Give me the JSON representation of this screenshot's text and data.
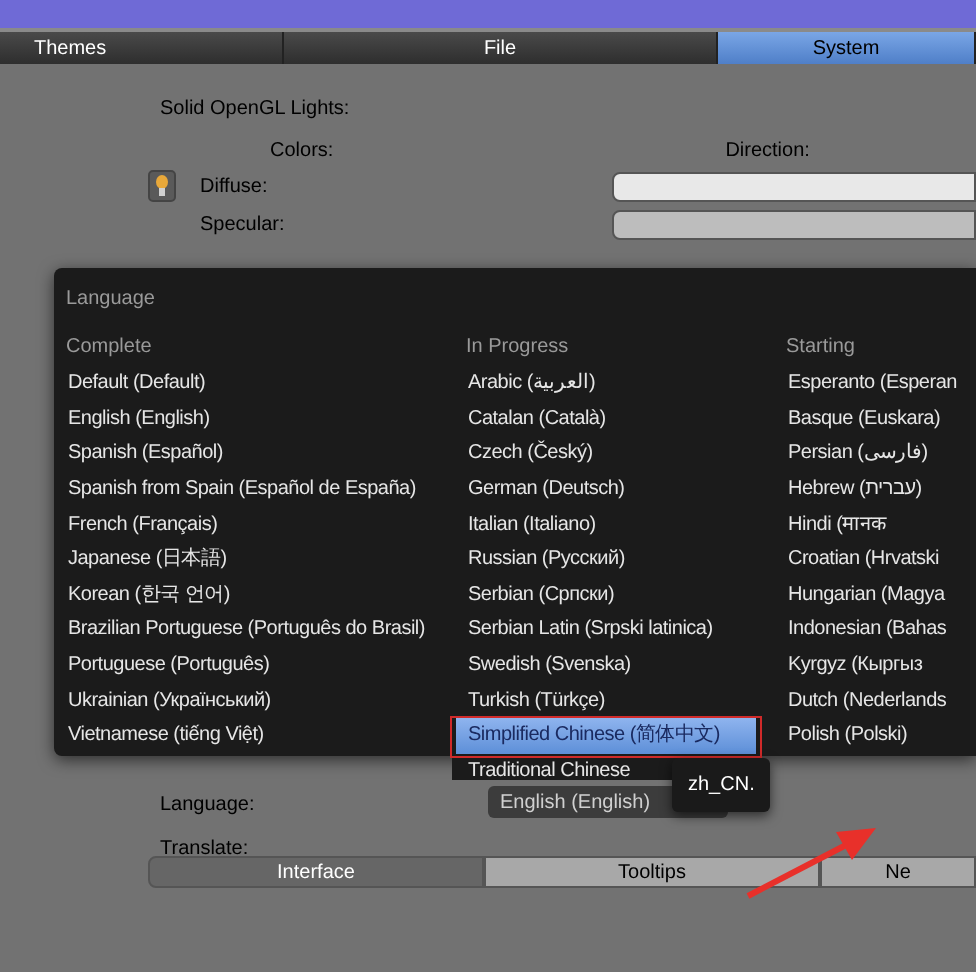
{
  "top_tabs": [
    {
      "label": "Themes",
      "selected": false
    },
    {
      "label": "File",
      "selected": false
    },
    {
      "label": "System",
      "selected": true
    }
  ],
  "lights": {
    "title": "Solid OpenGL Lights:",
    "colors_label": "Colors:",
    "direction_label": "Direction:",
    "rows": [
      {
        "label": "Diffuse:"
      },
      {
        "label": "Specular:"
      }
    ]
  },
  "language_popup": {
    "title": "Language",
    "columns": [
      {
        "header": "Complete",
        "items": [
          {
            "label": "Default (Default)",
            "selected": false
          },
          {
            "label": "English (English)",
            "selected": false
          },
          {
            "label": "Spanish (Español)",
            "selected": false
          },
          {
            "label": "Spanish from Spain (Español de España)",
            "selected": false
          },
          {
            "label": "French (Français)",
            "selected": false
          },
          {
            "label": "Japanese (日本語)",
            "selected": false
          },
          {
            "label": "Korean (한국 언어)",
            "selected": false
          },
          {
            "label": "Brazilian Portuguese (Português do Brasil)",
            "selected": false
          },
          {
            "label": "Portuguese (Português)",
            "selected": false
          },
          {
            "label": "Ukrainian (Український)",
            "selected": false
          },
          {
            "label": "Vietnamese (tiếng Việt)",
            "selected": false
          }
        ]
      },
      {
        "header": "In Progress",
        "items": [
          {
            "label": "Arabic (العربية)",
            "selected": false
          },
          {
            "label": "Catalan (Català)",
            "selected": false
          },
          {
            "label": "Czech (Český)",
            "selected": false
          },
          {
            "label": "German (Deutsch)",
            "selected": false
          },
          {
            "label": "Italian (Italiano)",
            "selected": false
          },
          {
            "label": "Russian (Русский)",
            "selected": false
          },
          {
            "label": "Serbian (Српски)",
            "selected": false
          },
          {
            "label": "Serbian Latin (Srpski latinica)",
            "selected": false
          },
          {
            "label": "Swedish (Svenska)",
            "selected": false
          },
          {
            "label": "Turkish (Türkçe)",
            "selected": false
          },
          {
            "label": "Simplified Chinese (简体中文)",
            "selected": true
          },
          {
            "label": "Traditional Chinese",
            "selected": false
          }
        ]
      },
      {
        "header": "Starting",
        "items": [
          {
            "label": "Esperanto (Esperan",
            "selected": false
          },
          {
            "label": "Basque (Euskara)",
            "selected": false
          },
          {
            "label": "Persian (فارسی)",
            "selected": false
          },
          {
            "label": "Hebrew (עברית)",
            "selected": false
          },
          {
            "label": "Hindi (मानक",
            "selected": false
          },
          {
            "label": "Croatian (Hrvatski",
            "selected": false
          },
          {
            "label": "Hungarian (Magya",
            "selected": false
          },
          {
            "label": "Indonesian (Bahas",
            "selected": false
          },
          {
            "label": "Kyrgyz (Кыргыз",
            "selected": false
          },
          {
            "label": "Dutch (Nederlands",
            "selected": false
          },
          {
            "label": "Polish (Polski)",
            "selected": false
          }
        ]
      }
    ]
  },
  "tooltip": "zh_CN.",
  "language_settings": {
    "language_label": "Language:",
    "language_value": "English (English)",
    "translate_label": "Translate:",
    "translate_tabs": [
      {
        "label": "Interface",
        "selected": true
      },
      {
        "label": "Tooltips",
        "selected": false
      },
      {
        "label": "Ne",
        "selected": false
      }
    ]
  }
}
